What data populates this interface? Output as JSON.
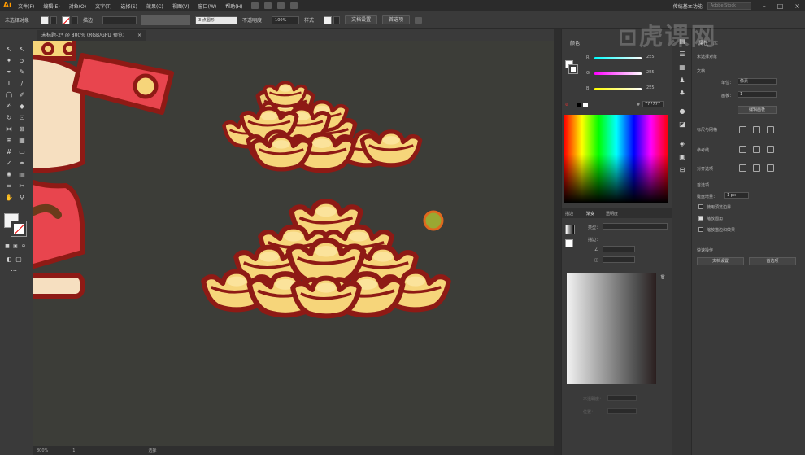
{
  "app": {
    "logo": "Ai"
  },
  "menu": [
    "文件(F)",
    "编辑(E)",
    "对象(O)",
    "文字(T)",
    "选择(S)",
    "效果(C)",
    "视图(V)",
    "窗口(W)",
    "帮助(H)"
  ],
  "workspace": {
    "label": "传统基本功能",
    "search_placeholder": "Adobe Stock"
  },
  "control_bar": {
    "selection": "未选择对象",
    "stroke_label": "描边：",
    "stroke_value": "",
    "brush": "3 点圆形",
    "opacity_label": "不透明度：",
    "opacity_value": "100%",
    "style_label": "样式：",
    "doc_setup": "文档设置",
    "preferences": "首选项"
  },
  "document": {
    "tab_title": "未标题-2* @ 800% (RGB/GPU 预览)",
    "close": "×"
  },
  "status": {
    "zoom": "800%",
    "artboard": "1",
    "mode": "选择"
  },
  "color_panel": {
    "title": "颜色",
    "channels": [
      {
        "label": "R",
        "value": "255",
        "color": "#e03030"
      },
      {
        "label": "G",
        "value": "255",
        "color": "#d040d0"
      },
      {
        "label": "B",
        "value": "255",
        "color": "#e0e030"
      }
    ],
    "hex": "777777"
  },
  "gradient_panel": {
    "tabs": [
      "描边",
      "渐变",
      "透明度"
    ],
    "type_label": "类型：",
    "stroke_label": "描边：",
    "opacity_label": "不透明度：",
    "location_label": "位置："
  },
  "properties": {
    "tabs": [
      "属性",
      "库"
    ],
    "none_selected": "未选择对象",
    "document_section": "文档",
    "units_label": "单位：",
    "units_value": "像素",
    "artboard_label": "画板：",
    "artboard_value": "1",
    "edit_artboard": "编辑画板",
    "rulers_section": "标尺与网格",
    "guides_section": "参考线",
    "snap_section": "对齐选项",
    "prefs_section": "首选项",
    "keyboard_inc_label": "键盘增量：",
    "keyboard_inc_value": "1 px",
    "options": [
      {
        "label": "使用预览边界",
        "checked": false
      },
      {
        "label": "缩放圆角",
        "checked": true
      },
      {
        "label": "缩放描边和效果",
        "checked": false
      }
    ],
    "quick_actions": "快速操作",
    "doc_setup": "文档设置",
    "preferences": "首选项"
  },
  "watermark": "虎课网",
  "colors": {
    "ingot_fill": "#f6d57a",
    "ingot_outline": "#8e1a15",
    "glow": "#c8302a",
    "cursor_fill": "#9aa832",
    "cursor_ring": "#e0681e",
    "char_red": "#e8454e",
    "char_skin": "#f6dfc0"
  }
}
